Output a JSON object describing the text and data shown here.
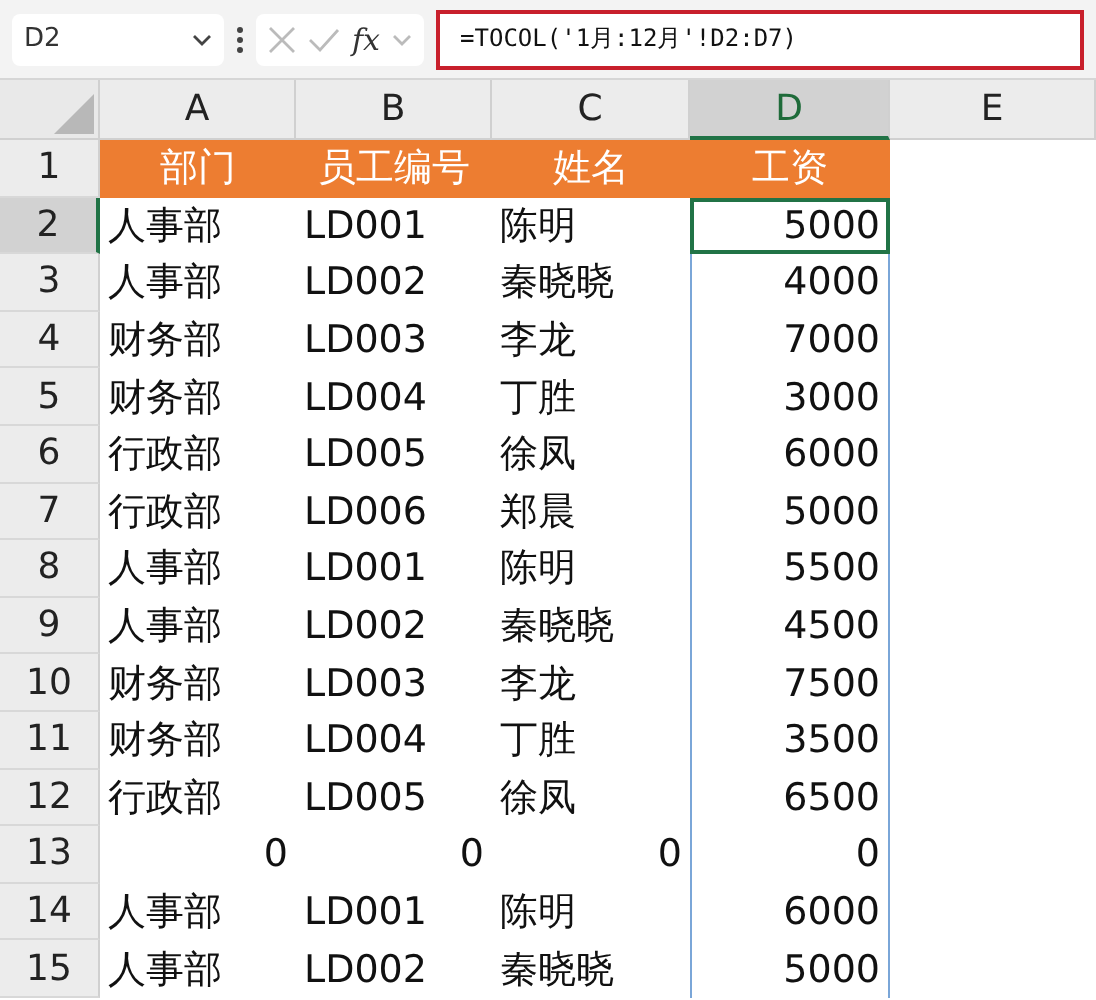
{
  "formula_bar": {
    "name_box": "D2",
    "fx_label": "fx",
    "formula": "=TOCOL('1月:12月'!D2:D7)",
    "highlighted": true
  },
  "sheet": {
    "columns": [
      {
        "label": "A",
        "selected": false
      },
      {
        "label": "B",
        "selected": false
      },
      {
        "label": "C",
        "selected": false
      },
      {
        "label": "D",
        "selected": true
      },
      {
        "label": "E",
        "selected": false
      }
    ],
    "header_row": {
      "number": "1",
      "cells": [
        "部门",
        "员工编号",
        "姓名",
        "工资"
      ]
    },
    "rows": [
      {
        "number": "2",
        "kind": "data",
        "selected": true,
        "cells": [
          "人事部",
          "LD001",
          "陈明",
          "5000"
        ]
      },
      {
        "number": "3",
        "kind": "data",
        "selected": false,
        "cells": [
          "人事部",
          "LD002",
          "秦晓晓",
          "4000"
        ]
      },
      {
        "number": "4",
        "kind": "data",
        "selected": false,
        "cells": [
          "财务部",
          "LD003",
          "李龙",
          "7000"
        ]
      },
      {
        "number": "5",
        "kind": "data",
        "selected": false,
        "cells": [
          "财务部",
          "LD004",
          "丁胜",
          "3000"
        ]
      },
      {
        "number": "6",
        "kind": "data",
        "selected": false,
        "cells": [
          "行政部",
          "LD005",
          "徐凤",
          "6000"
        ]
      },
      {
        "number": "7",
        "kind": "data",
        "selected": false,
        "cells": [
          "行政部",
          "LD006",
          "郑晨",
          "5000"
        ]
      },
      {
        "number": "8",
        "kind": "data",
        "selected": false,
        "cells": [
          "人事部",
          "LD001",
          "陈明",
          "5500"
        ]
      },
      {
        "number": "9",
        "kind": "data",
        "selected": false,
        "cells": [
          "人事部",
          "LD002",
          "秦晓晓",
          "4500"
        ]
      },
      {
        "number": "10",
        "kind": "data",
        "selected": false,
        "cells": [
          "财务部",
          "LD003",
          "李龙",
          "7500"
        ]
      },
      {
        "number": "11",
        "kind": "data",
        "selected": false,
        "cells": [
          "财务部",
          "LD004",
          "丁胜",
          "3500"
        ]
      },
      {
        "number": "12",
        "kind": "data",
        "selected": false,
        "cells": [
          "行政部",
          "LD005",
          "徐凤",
          "6500"
        ]
      },
      {
        "number": "13",
        "kind": "numeric",
        "selected": false,
        "cells": [
          "0",
          "0",
          "0",
          "0"
        ]
      },
      {
        "number": "14",
        "kind": "data",
        "selected": false,
        "cells": [
          "人事部",
          "LD001",
          "陈明",
          "6000"
        ]
      },
      {
        "number": "15",
        "kind": "data",
        "selected": false,
        "cells": [
          "人事部",
          "LD002",
          "秦晓晓",
          "5000"
        ]
      }
    ]
  }
}
